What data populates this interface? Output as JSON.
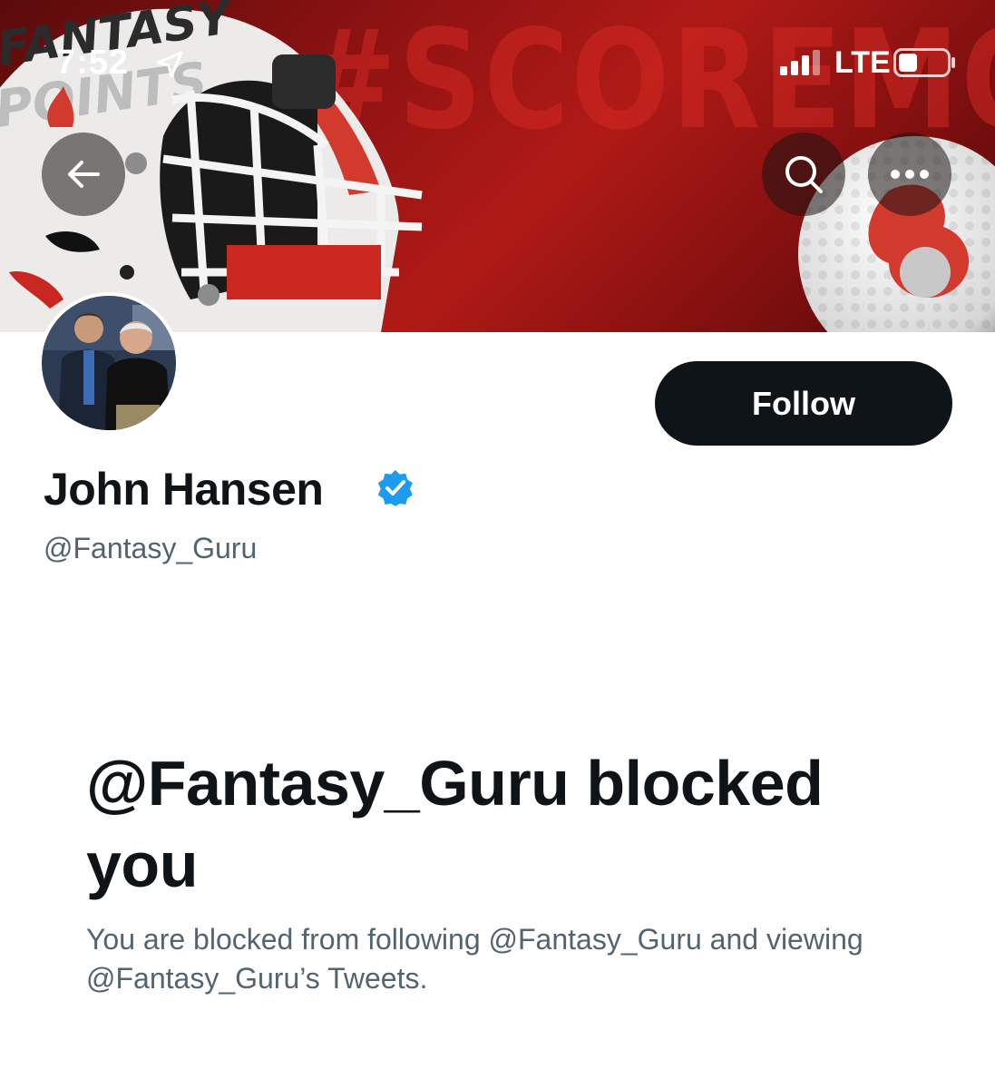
{
  "status_bar": {
    "time": "7:52",
    "network": "LTE"
  },
  "banner": {
    "hashtag": "#SCOREMORE",
    "helmet_logo_line1": "FANTASY",
    "helmet_logo_line2": "POINTS"
  },
  "header_actions": {
    "back_icon": "back-arrow-icon",
    "search_icon": "search-icon",
    "more_icon": "more-dots-icon"
  },
  "profile": {
    "display_name": "John Hansen",
    "handle": "@Fantasy_Guru",
    "verified": true,
    "follow_label": "Follow"
  },
  "blocked_notice": {
    "title": "@Fantasy_Guru blocked you",
    "description": "You are blocked from following @Fantasy_Guru and viewing @Fantasy_Guru’s Tweets."
  },
  "colors": {
    "banner_red": "#b01a16",
    "follow_button": "#0f1419",
    "verified_blue": "#1d9bf0",
    "secondary_text": "#536471"
  }
}
